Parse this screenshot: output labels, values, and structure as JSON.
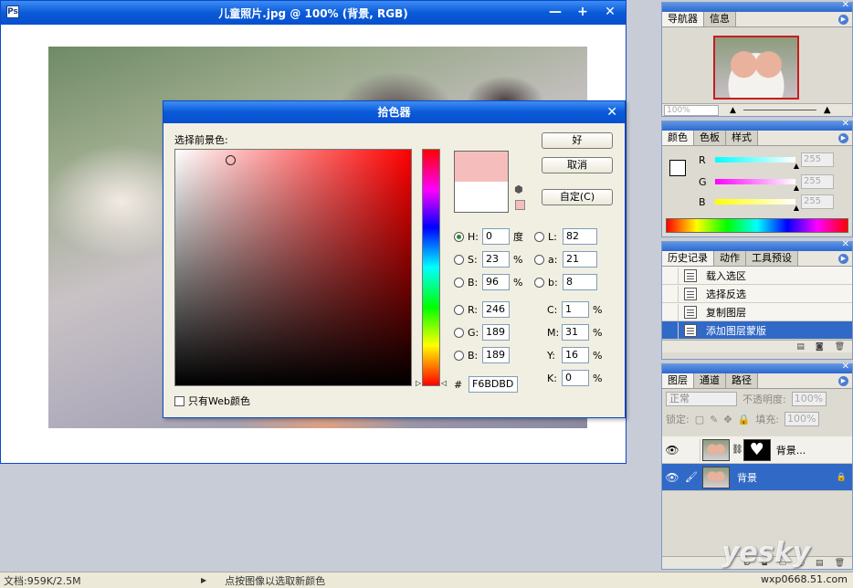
{
  "doc_window": {
    "title": "儿童照片.jpg @ 100% (背景, RGB)"
  },
  "picker": {
    "title": "拾色器",
    "label": "选择前景色:",
    "buttons": {
      "ok": "好",
      "cancel": "取消",
      "custom": "自定(C)"
    },
    "fields": {
      "H": {
        "label": "H:",
        "value": "0",
        "unit": "度"
      },
      "S": {
        "label": "S:",
        "value": "23",
        "unit": "%"
      },
      "Bv": {
        "label": "B:",
        "value": "96",
        "unit": "%"
      },
      "R": {
        "label": "R:",
        "value": "246"
      },
      "G": {
        "label": "G:",
        "value": "189"
      },
      "B": {
        "label": "B:",
        "value": "189"
      },
      "L": {
        "label": "L:",
        "value": "82"
      },
      "a": {
        "label": "a:",
        "value": "21"
      },
      "b": {
        "label": "b:",
        "value": "8"
      },
      "C": {
        "label": "C:",
        "value": "1",
        "unit": "%"
      },
      "M": {
        "label": "M:",
        "value": "31",
        "unit": "%"
      },
      "Y": {
        "label": "Y:",
        "value": "16",
        "unit": "%"
      },
      "K": {
        "label": "K:",
        "value": "0",
        "unit": "%"
      }
    },
    "hex_label": "#",
    "hex": "F6BDBD",
    "web_only": "只有Web颜色",
    "new_color": "#F6BDBD",
    "current_color": "#FFFFFF"
  },
  "navigator": {
    "tabs": [
      "导航器",
      "信息"
    ],
    "zoom": "100%"
  },
  "color_panel": {
    "tabs": [
      "颜色",
      "色板",
      "样式"
    ],
    "rows": [
      {
        "label": "R",
        "value": "255"
      },
      {
        "label": "G",
        "value": "255"
      },
      {
        "label": "B",
        "value": "255"
      }
    ]
  },
  "history": {
    "tabs": [
      "历史记录",
      "动作",
      "工具预设"
    ],
    "items": [
      "载入选区",
      "选择反选",
      "复制图层",
      "添加图层蒙版"
    ]
  },
  "layers": {
    "tabs": [
      "图层",
      "通道",
      "路径"
    ],
    "blend": "正常",
    "opacity_label": "不透明度:",
    "opacity": "100%",
    "lock_label": "锁定:",
    "fill_label": "填充:",
    "fill": "100%",
    "items": [
      {
        "name": "背景..."
      },
      {
        "name": "背景"
      }
    ]
  },
  "status": {
    "doc_info": "文档:959K/2.5M",
    "hint": "点按图像以选取新颜色",
    "watermark": "wxp0668.51.com",
    "watermark_logo": "yesky"
  }
}
